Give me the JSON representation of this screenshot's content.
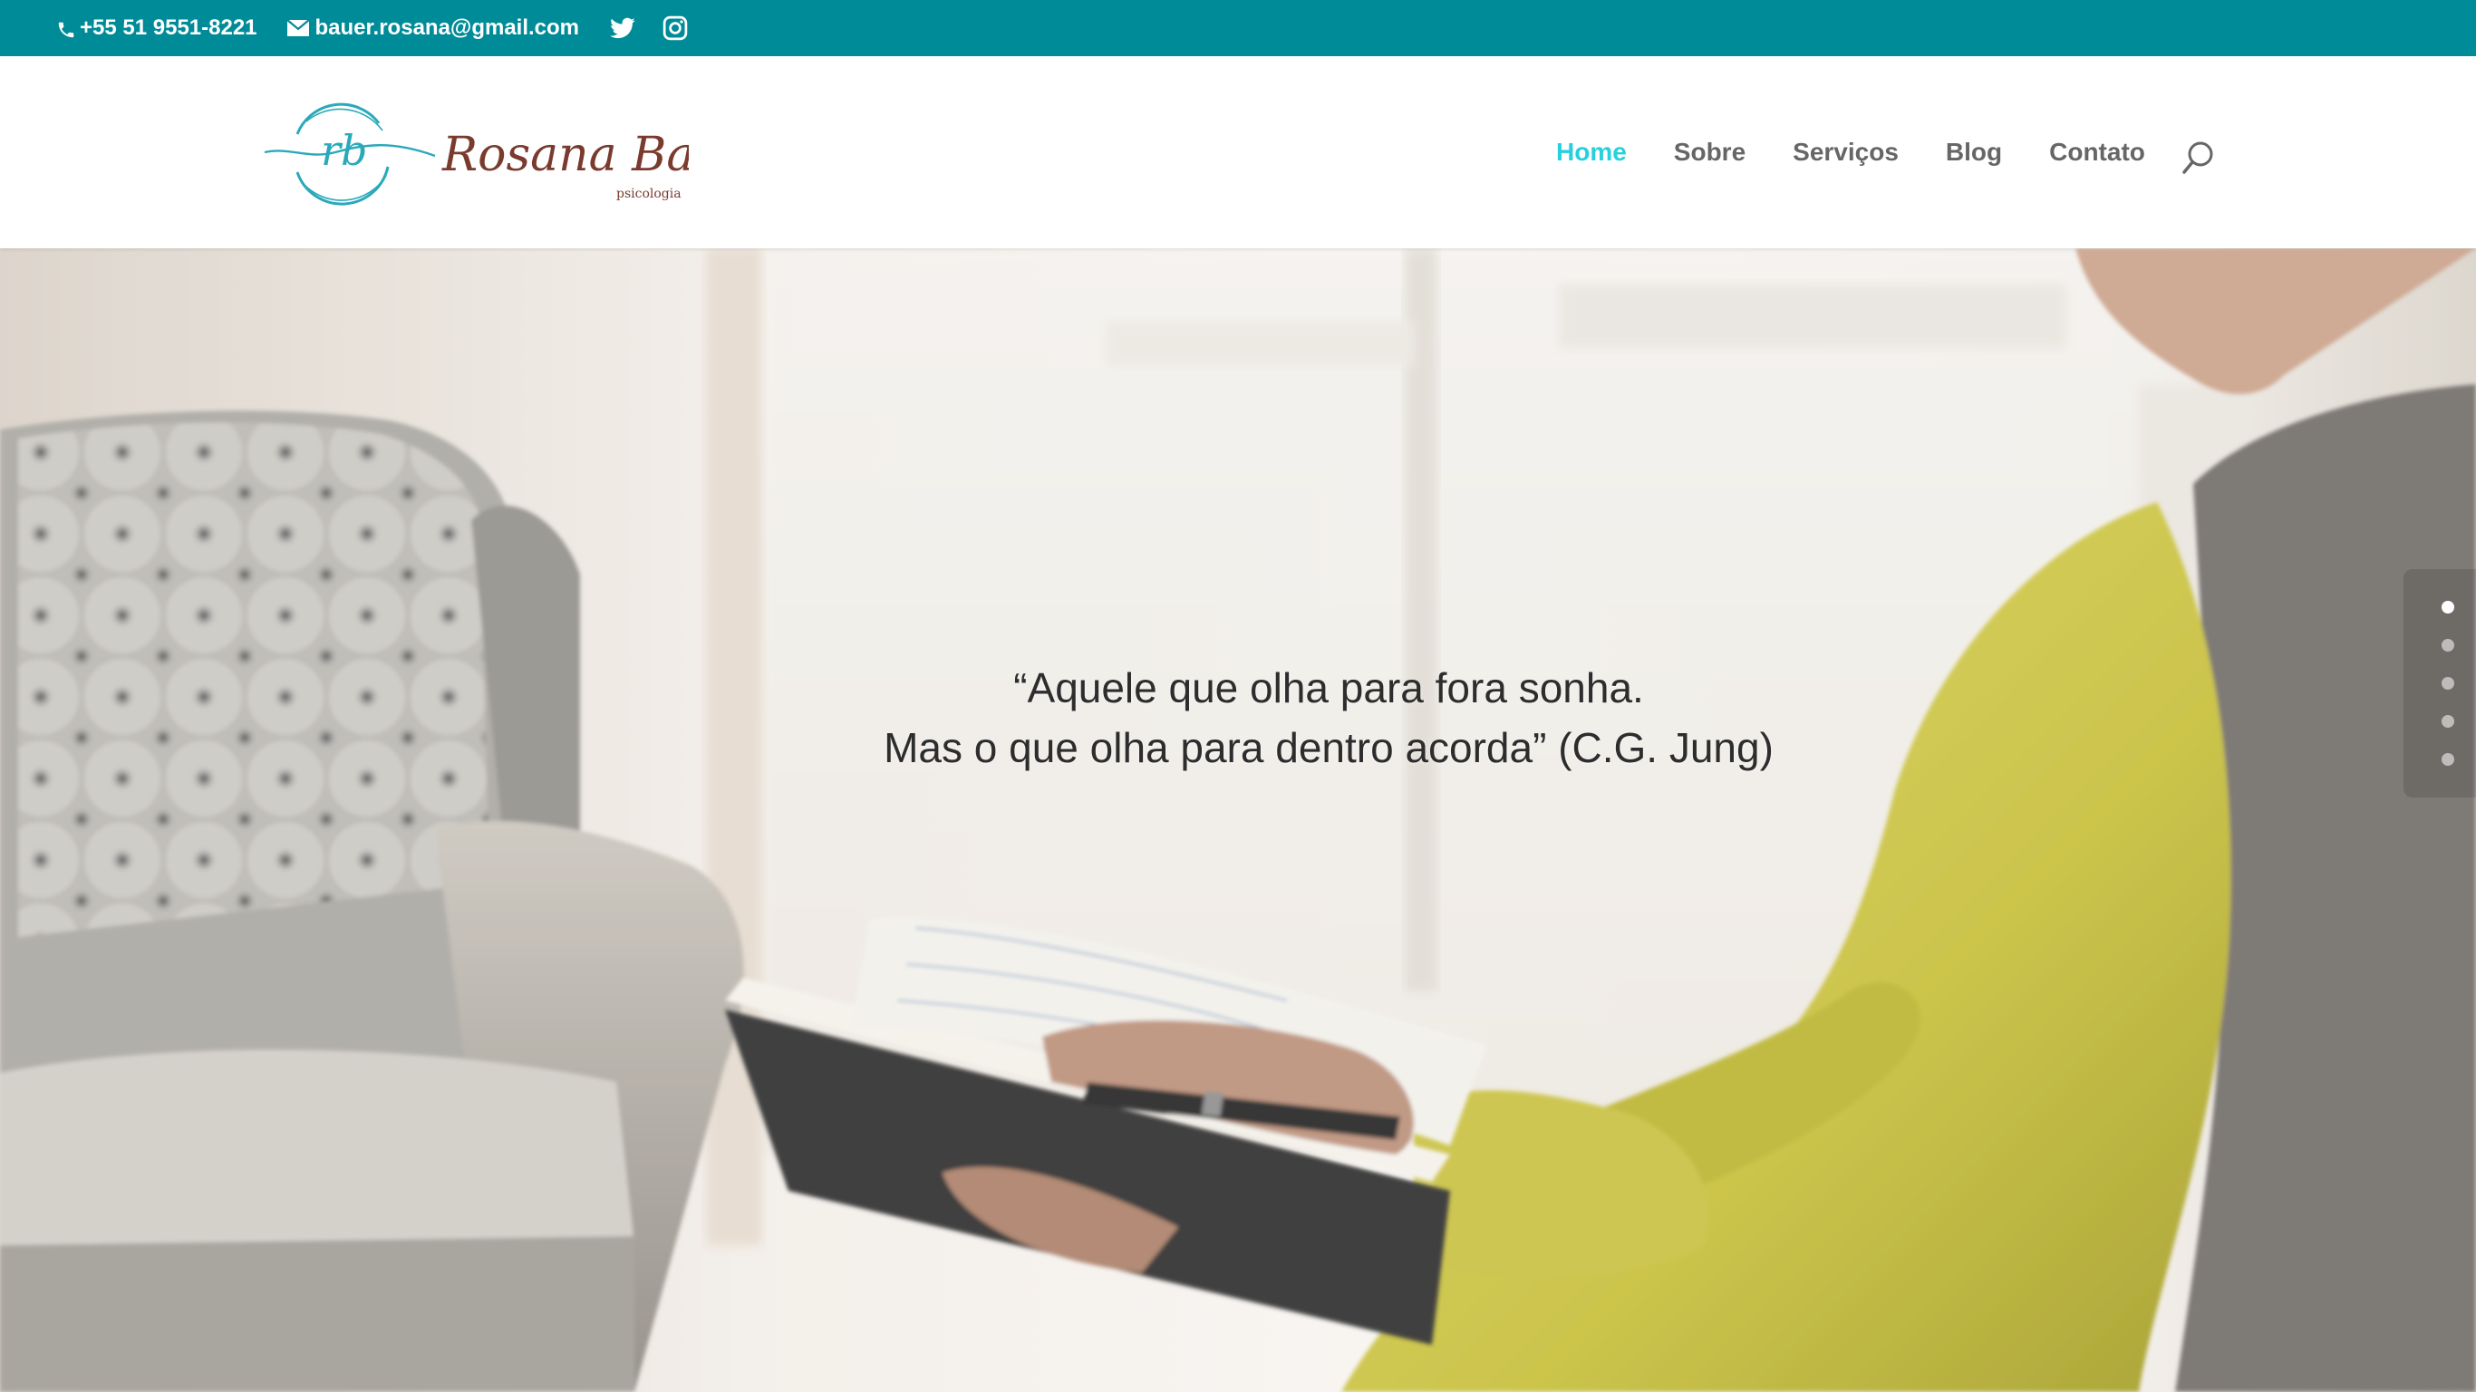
{
  "topbar": {
    "phone": "+55 51 9551-8221",
    "email": "bauer.rosana@gmail.com",
    "background": "#008b98",
    "social": [
      "twitter-icon",
      "instagram-icon"
    ]
  },
  "header": {
    "logo": {
      "monogram": "rb",
      "name": "Rosana Bauer",
      "subtitle": "psicologia"
    },
    "nav": [
      {
        "label": "Home",
        "active": true
      },
      {
        "label": "Sobre",
        "active": false
      },
      {
        "label": "Serviços",
        "active": false
      },
      {
        "label": "Blog",
        "active": false
      },
      {
        "label": "Contato",
        "active": false
      }
    ],
    "accent": "#26d0de",
    "search_icon": "search-icon"
  },
  "hero": {
    "quote_line1": "“Aquele que olha para fora sonha.",
    "quote_line2": "Mas o que olha para dentro acorda” (C.G. Jung)",
    "slides": 5,
    "active_slide": 1
  }
}
